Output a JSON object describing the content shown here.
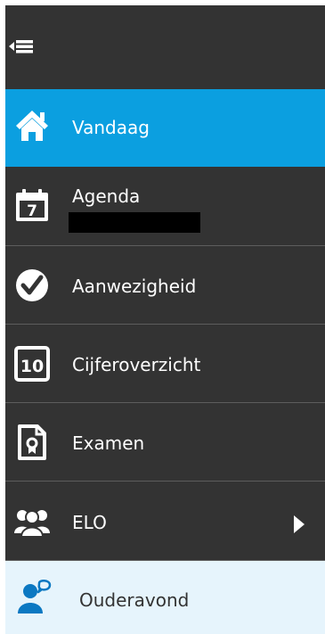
{
  "menu": {
    "items": [
      {
        "label": "Vandaag",
        "icon": "home-icon",
        "active": true
      },
      {
        "label": "Agenda",
        "icon": "calendar-icon",
        "badge": "7"
      },
      {
        "label": "Aanwezigheid",
        "icon": "checkmark-circle-icon"
      },
      {
        "label": "Cijferoverzicht",
        "icon": "grade-10-icon",
        "badge": "10"
      },
      {
        "label": "Examen",
        "icon": "exam-document-icon"
      },
      {
        "label": "ELO",
        "icon": "group-icon",
        "has_submenu": true
      },
      {
        "label": "Ouderavond",
        "icon": "parent-meeting-icon"
      }
    ]
  },
  "colors": {
    "background": "#333333",
    "active": "#0b9fe0",
    "divider": "#5d5d5d",
    "highlight_row": "#e6f4fc",
    "icon_blue": "#0b78c2"
  }
}
